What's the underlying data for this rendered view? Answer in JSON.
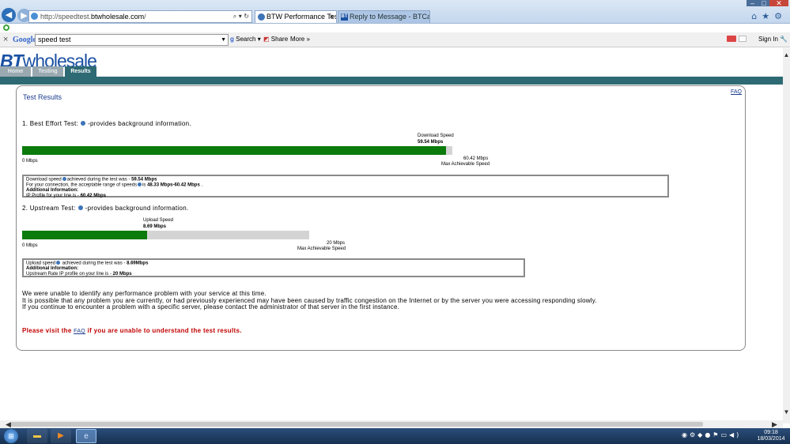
{
  "browser": {
    "address_host": "http://speedtest.",
    "address_domain": "btwholesale.com",
    "address_rest": "/",
    "tabs": [
      {
        "label": "BTW Performance Test",
        "close": "×"
      },
      {
        "label": "Reply to Message - BTCare Co...",
        "close": ""
      }
    ],
    "window_controls": [
      "–",
      "□",
      "✕"
    ],
    "toolbar_icons": [
      "home-icon",
      "star-icon",
      "gear-icon"
    ]
  },
  "google_toolbar": {
    "close": "×",
    "logo": "Google",
    "search_value": "speed test",
    "search_button": "Search",
    "share_button": "Share",
    "more_button": "More »",
    "signin": "Sign In"
  },
  "site": {
    "logo_bt": "BT",
    "logo_rest": "wholesale",
    "nav_tabs": [
      "Home",
      "Testing",
      "Results"
    ],
    "faq": "FAQ",
    "title": "Test Results"
  },
  "download": {
    "heading": "1. Best Effort Test:",
    "heading_suffix": "-provides background information.",
    "speed_label": "Download Speed",
    "speed_value": "59.54 Mbps",
    "fill_fraction": 0.9851,
    "min_label": "0 Mbps",
    "max_value": "60.42 Mbps",
    "max_label": "Max Achievable Speed",
    "info_line1_a": "Download speed",
    "info_line1_b": "achieved during the test was - ",
    "info_line1_val": "59.54 Mbps",
    "info_line2_a": "For your connection, the acceptable range of speeds",
    "info_line2_b": "is ",
    "info_line2_val": "48.33 Mbps-60.42 Mbps",
    "info_line2_end": " .",
    "info_line3": "Additional Information:",
    "info_line4_a": "IP Profile for your line is - ",
    "info_line4_val": "60.42 Mbps"
  },
  "upload": {
    "heading": "2. Upstream Test:",
    "heading_suffix": "-provides background information.",
    "speed_label": "Upload Speed",
    "speed_value": "8.69 Mbps",
    "fill_fraction": 0.4345,
    "min_label": "0 Mbps",
    "max_value": "20 Mbps",
    "max_label": "Max Achievable Speed",
    "info_line1_a": "Upload speed",
    "info_line1_b": " achieved during the test was - ",
    "info_line1_val": "8.69Mbps",
    "info_line2": "Additional Information:",
    "info_line3_a": "Upstream Rate IP profile on your line is - ",
    "info_line3_val": "20 Mbps"
  },
  "messages": {
    "line1": "We were unable to identify any performance problem with your service at this time.",
    "line2": "It is possible that any problem you are currently, or had previously experienced may have been caused by traffic congestion on the Internet or by the server you were accessing responding slowly.",
    "line3": "If you continue to encounter a problem with a specific server, please contact the administrator of that server in the first instance.",
    "red_a": "Please visit the ",
    "red_link": "FAQ",
    "red_b": " if you are unable to understand the test results."
  },
  "taskbar": {
    "time": "09:18",
    "date": "18/03/2014"
  },
  "colors": {
    "bar_fill": "#0b7b0b",
    "bar_track": "#d4d4d4",
    "brand": "#1a50a3",
    "teal": "#2e6a73",
    "warning": "#c00000"
  }
}
